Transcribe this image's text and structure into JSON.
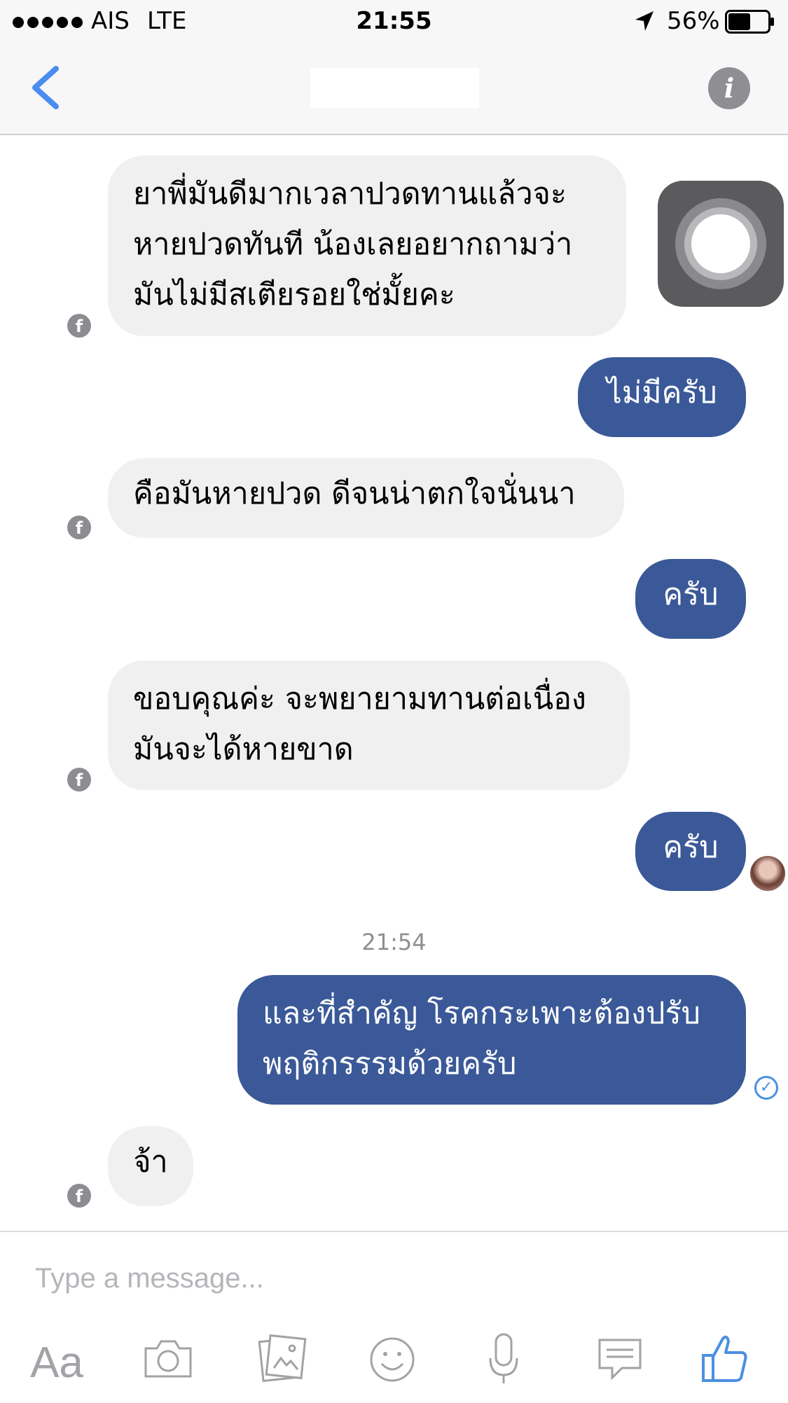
{
  "status_bar": {
    "carrier": "AIS",
    "network": "LTE",
    "time": "21:55",
    "battery": "56%",
    "battery_level": 0.56
  },
  "nav": {
    "back_icon": "chevron-left-icon",
    "info_icon": "info-icon",
    "info_glyph": "i"
  },
  "messages": {
    "m1": {
      "line1": "ยาพี่มันดีมากเวลาปวดทานแล้วจะ",
      "line2": "หายปวดทันที น้องเลยอยากถามว่า",
      "line3": "มันไม่มีสเตียรอยใช่มั้ยคะ"
    },
    "m2": "ไม่มีครับ",
    "m3": "คือมันหายปวด ดีจนน่าตกใจนั่นนา",
    "m4": "ครับ",
    "m5": {
      "line1": "ขอบคุณค่ะ จะพยายามทานต่อเนื่อง",
      "line2": "มันจะได้หายขาด"
    },
    "m6": "ครับ",
    "timestamp": "21:54",
    "m7": {
      "line1": "และที่สำคัญ โรคกระเพาะต้องปรับ",
      "line2": "พฤติกรรรมด้วยครับ"
    },
    "m8": "จ้า"
  },
  "composer": {
    "placeholder": "Type a message...",
    "text_label": "Aa"
  },
  "colors": {
    "outgoing_bubble": "#3b5998",
    "incoming_bubble": "#f1f0f0",
    "accent": "#4a90e2",
    "toolbar_icon": "#a2a2a7"
  }
}
